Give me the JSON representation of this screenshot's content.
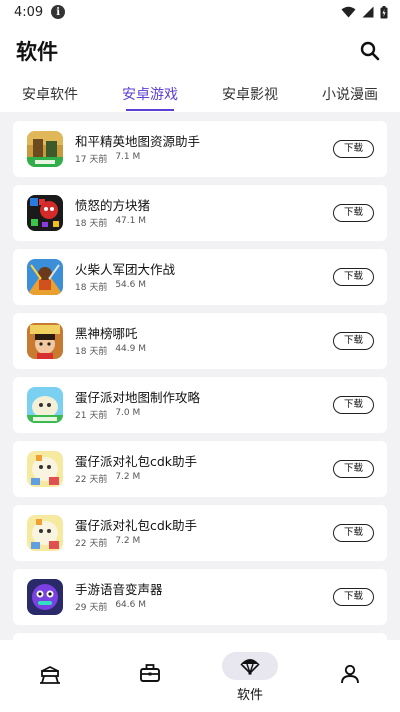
{
  "status_bar": {
    "time": "4:09",
    "info_icon": "i"
  },
  "header": {
    "title": "软件",
    "search_icon": "search-icon"
  },
  "tabs": [
    {
      "label": "安卓软件",
      "active": false
    },
    {
      "label": "安卓游戏",
      "active": true
    },
    {
      "label": "安卓影视",
      "active": false
    },
    {
      "label": "小说漫画",
      "active": false
    }
  ],
  "apps": [
    {
      "name": "和平精英地图资源助手",
      "age": "17 天前",
      "size": "7.1 M",
      "button": "下载"
    },
    {
      "name": "愤怒的方块猪",
      "age": "18 天前",
      "size": "47.1 M",
      "button": "下载"
    },
    {
      "name": "火柴人军团大作战",
      "age": "18 天前",
      "size": "54.6 M",
      "button": "下载"
    },
    {
      "name": "黑神榜哪吒",
      "age": "18 天前",
      "size": "44.9 M",
      "button": "下载"
    },
    {
      "name": "蛋仔派对地图制作攻略",
      "age": "21 天前",
      "size": "7.0 M",
      "button": "下载"
    },
    {
      "name": "蛋仔派对礼包cdk助手",
      "age": "22 天前",
      "size": "7.2 M",
      "button": "下载"
    },
    {
      "name": "蛋仔派对礼包cdk助手",
      "age": "22 天前",
      "size": "7.2 M",
      "button": "下载"
    },
    {
      "name": "手游语音变声器",
      "age": "29 天前",
      "size": "64.6 M",
      "button": "下载"
    }
  ],
  "bottom_nav": {
    "items": [
      {
        "icon": "stand-icon",
        "label": ""
      },
      {
        "icon": "toolbox-icon",
        "label": ""
      },
      {
        "icon": "parachute-icon",
        "label": "软件",
        "active": true
      },
      {
        "icon": "person-icon",
        "label": ""
      }
    ]
  },
  "colors": {
    "accent": "#5c3fd6",
    "background": "#f2f2f4"
  }
}
